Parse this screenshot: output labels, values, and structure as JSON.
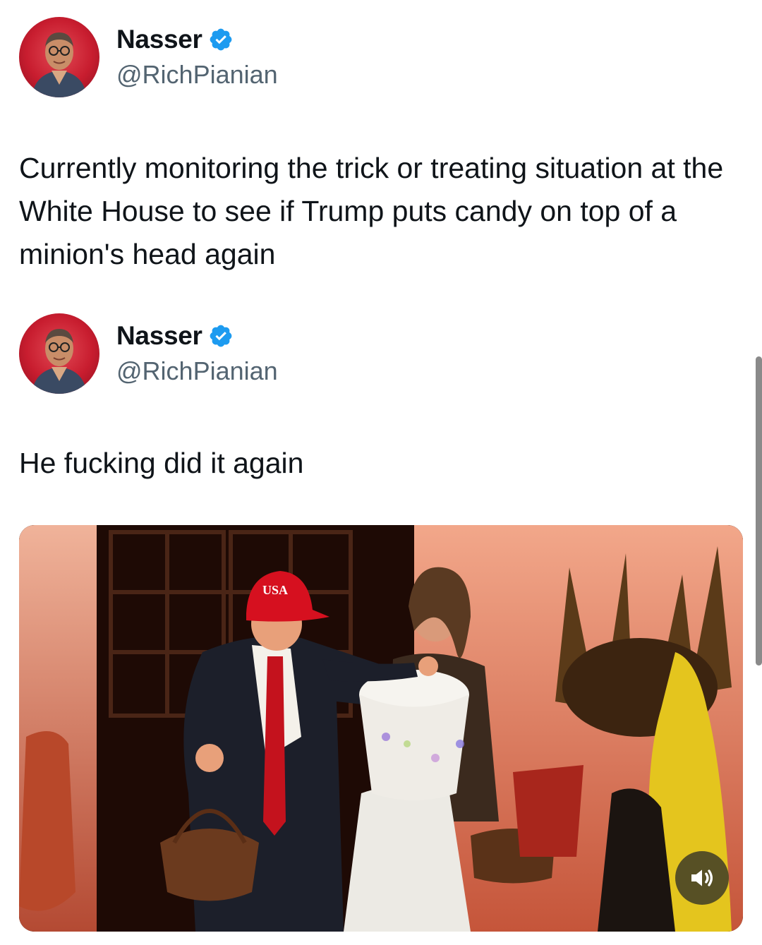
{
  "tweets": [
    {
      "display_name": "Nasser",
      "handle": "@RichPianian",
      "verified": true,
      "text": "Currently monitoring the trick or treating situation at the White House to see if Trump puts candy on top of a minion's head again"
    },
    {
      "display_name": "Nasser",
      "handle": "@RichPianian",
      "verified": true,
      "text": "He fucking did it again"
    }
  ],
  "media": {
    "type": "video",
    "hat_text": "USA",
    "volume_icon": "speaker-volume-icon"
  },
  "colors": {
    "verified_blue": "#1d9bf0",
    "handle_gray": "#536471",
    "text": "#0f1419"
  }
}
